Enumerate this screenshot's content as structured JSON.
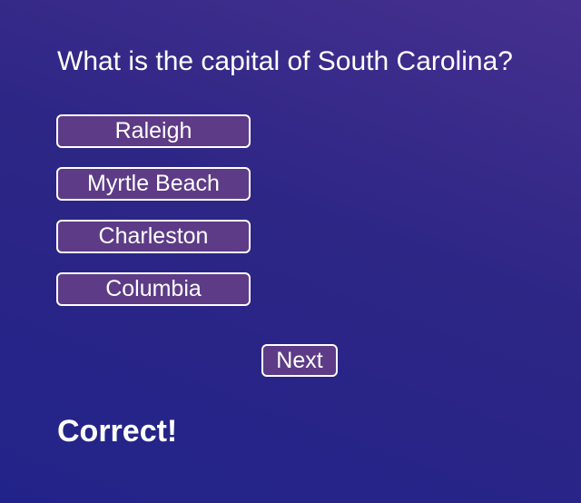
{
  "quiz": {
    "question": "What is the capital of South Carolina?",
    "answers": [
      {
        "label": "Raleigh"
      },
      {
        "label": "Myrtle Beach"
      },
      {
        "label": "Charleston"
      },
      {
        "label": "Columbia"
      }
    ],
    "next_label": "Next",
    "feedback": "Correct!"
  },
  "colors": {
    "background_top": "#46308f",
    "background_bottom": "#22238a",
    "button_fill": "#5d3b87",
    "button_border": "#ffffff",
    "text": "#ffffff"
  }
}
